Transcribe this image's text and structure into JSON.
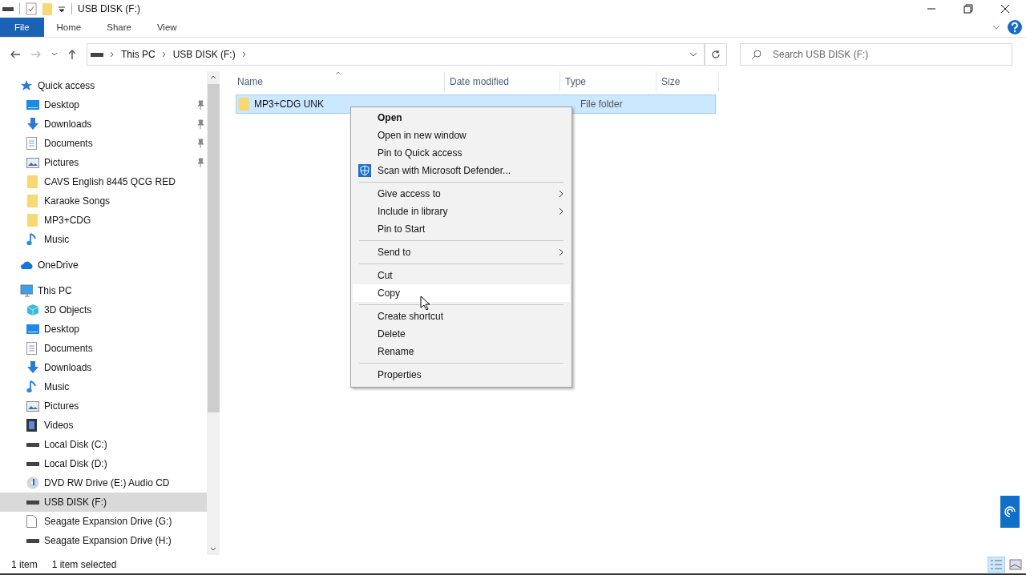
{
  "window": {
    "title": "USB DISK (F:)"
  },
  "ribbon_tabs": [
    {
      "label": "File",
      "selected": true
    },
    {
      "label": "Home",
      "selected": false
    },
    {
      "label": "Share",
      "selected": false
    },
    {
      "label": "View",
      "selected": false
    }
  ],
  "address": {
    "crumbs": [
      "This PC",
      "USB DISK (F:)"
    ]
  },
  "search": {
    "placeholder": "Search USB DISK (F:)"
  },
  "sidebar": {
    "items": [
      {
        "label": "Quick access",
        "kind": "star",
        "selected": false,
        "children": [
          {
            "label": "Desktop",
            "kind": "desktop",
            "pinned": true,
            "selected": false
          },
          {
            "label": "Downloads",
            "kind": "download",
            "pinned": true,
            "selected": false
          },
          {
            "label": "Documents",
            "kind": "document",
            "pinned": true,
            "selected": false
          },
          {
            "label": "Pictures",
            "kind": "picture",
            "pinned": true,
            "selected": false
          },
          {
            "label": "CAVS English 8445 QCG RED",
            "kind": "folder",
            "pinned": false,
            "selected": false
          },
          {
            "label": "Karaoke Songs",
            "kind": "folder",
            "pinned": false,
            "selected": false
          },
          {
            "label": "MP3+CDG",
            "kind": "folder",
            "pinned": false,
            "selected": false
          },
          {
            "label": "Music",
            "kind": "music",
            "pinned": false,
            "selected": false
          }
        ]
      },
      {
        "label": "OneDrive",
        "kind": "cloud",
        "selected": false
      },
      {
        "label": "This PC",
        "kind": "pc",
        "selected": false,
        "children": [
          {
            "label": "3D Objects",
            "kind": "cube",
            "selected": false
          },
          {
            "label": "Desktop",
            "kind": "desktop",
            "selected": false
          },
          {
            "label": "Documents",
            "kind": "document",
            "selected": false
          },
          {
            "label": "Downloads",
            "kind": "download",
            "selected": false
          },
          {
            "label": "Music",
            "kind": "music",
            "selected": false
          },
          {
            "label": "Pictures",
            "kind": "picture",
            "selected": false
          },
          {
            "label": "Videos",
            "kind": "video",
            "selected": false
          },
          {
            "label": "Local Disk (C:)",
            "kind": "disk",
            "selected": false
          },
          {
            "label": "Local Disk (D:)",
            "kind": "disk",
            "selected": false
          },
          {
            "label": "DVD RW Drive (E:) Audio CD",
            "kind": "dvd",
            "selected": false
          },
          {
            "label": "USB DISK (F:)",
            "kind": "disk",
            "selected": true
          },
          {
            "label": "Seagate Expansion Drive (G:)",
            "kind": "file",
            "selected": false
          },
          {
            "label": "Seagate Expansion Drive (H:)",
            "kind": "disk",
            "selected": false
          }
        ]
      }
    ]
  },
  "table": {
    "columns": [
      "Name",
      "Date modified",
      "Type",
      "Size"
    ],
    "rows": [
      {
        "name": "MP3+CDG UNK",
        "type": "File folder",
        "selected": true
      }
    ]
  },
  "context_menu": {
    "items": [
      {
        "kind": "item",
        "label": "Open",
        "bold": true,
        "submenu": false,
        "selected": false
      },
      {
        "kind": "item",
        "label": "Open in new window",
        "bold": false,
        "submenu": false,
        "selected": false
      },
      {
        "kind": "item",
        "label": "Pin to Quick access",
        "bold": false,
        "submenu": false,
        "selected": false
      },
      {
        "kind": "shield",
        "label": "Scan with Microsoft Defender...",
        "bold": false,
        "submenu": false,
        "selected": false
      },
      {
        "kind": "separator"
      },
      {
        "kind": "item",
        "label": "Give access to",
        "bold": false,
        "submenu": true,
        "selected": false
      },
      {
        "kind": "item",
        "label": "Include in library",
        "bold": false,
        "submenu": true,
        "selected": false
      },
      {
        "kind": "item",
        "label": "Pin to Start",
        "bold": false,
        "submenu": false,
        "selected": false
      },
      {
        "kind": "separator"
      },
      {
        "kind": "item",
        "label": "Send to",
        "bold": false,
        "submenu": true,
        "selected": false
      },
      {
        "kind": "separator"
      },
      {
        "kind": "item",
        "label": "Cut",
        "bold": false,
        "submenu": false,
        "selected": false
      },
      {
        "kind": "item",
        "label": "Copy",
        "bold": false,
        "submenu": false,
        "selected": true
      },
      {
        "kind": "separator"
      },
      {
        "kind": "item",
        "label": "Create shortcut",
        "bold": false,
        "submenu": false,
        "selected": false
      },
      {
        "kind": "item",
        "label": "Delete",
        "bold": false,
        "submenu": false,
        "selected": false
      },
      {
        "kind": "item",
        "label": "Rename",
        "bold": false,
        "submenu": false,
        "selected": false
      },
      {
        "kind": "separator"
      },
      {
        "kind": "item",
        "label": "Properties",
        "bold": false,
        "submenu": false,
        "selected": false
      }
    ]
  },
  "status_bar": {
    "count": "1 item",
    "selection": "1 item selected"
  }
}
